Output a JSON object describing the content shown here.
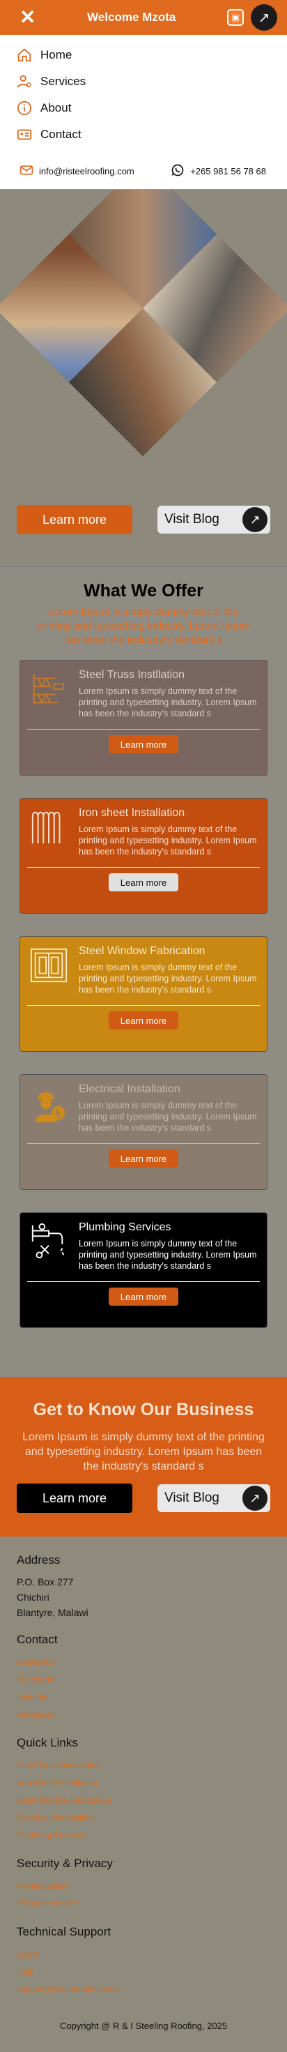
{
  "topbar": {
    "title": "Welcome Mzota"
  },
  "menu": [
    {
      "label": "Home"
    },
    {
      "label": "Services"
    },
    {
      "label": "About"
    },
    {
      "label": "Contact"
    }
  ],
  "contact": {
    "email": "info@risteelroofing.com",
    "phone": "+265 981 56 78 68"
  },
  "hero": {
    "learn_more": "Learn more",
    "visit_blog": "Visit Blog"
  },
  "offer": {
    "title": "What We Offer",
    "subtitle": "Lorem Ipsum is simply dummy text of the printing and typesetting industry. Lorem Ipsum has been the industry's standard s",
    "cards": [
      {
        "title": "Steel Truss Instllation",
        "text": "Lorem Ipsum is simply dummy text of the printing and typesetting industry. Lorem Ipsum has been the industry's standard s",
        "button": "Learn more",
        "bg": "#7a6660",
        "fg": "#d9cbc6",
        "btn_bg": "#d15a14",
        "btn_fg": "#fff"
      },
      {
        "title": "Iron sheet Installation",
        "text": "Lorem Ipsum is simply dummy text of the printing and typesetting industry. Lorem Ipsum has been the industry's standard s",
        "button": "Learn more",
        "bg": "#c24d0e",
        "fg": "#fbe2d3",
        "btn_bg": "#e0e0e0",
        "btn_fg": "#111"
      },
      {
        "title": "Steel Window Fabrication",
        "text": "Lorem Ipsum is simply dummy text of the printing and typesetting industry. Lorem Ipsum has been the industry's standard s",
        "button": "Learn more",
        "bg": "#c88812",
        "fg": "#fbe8c7",
        "btn_bg": "#d15a14",
        "btn_fg": "#fff"
      },
      {
        "title": "Electrical Installation",
        "text": "Lorem Ipsum is simply dummy text of the printing and typesetting industry. Lorem Ipsum has been the industry's standard s",
        "button": "Learn more",
        "bg": "#8a7d70",
        "fg": "#c9b9a8",
        "btn_bg": "#d15a14",
        "btn_fg": "#fff"
      },
      {
        "title": "Plumbing Services",
        "text": "Lorem Ipsum is simply dummy text of the printing and typesetting industry. Lorem Ipsum has been the industry's standard s",
        "button": "Learn more",
        "bg": "#000000",
        "fg": "#ffffff",
        "btn_bg": "#d15a14",
        "btn_fg": "#fff"
      }
    ]
  },
  "business": {
    "title": "Get to Know Our Business",
    "text": "Lorem Ipsum is simply dummy text of the printing and typesetting industry. Lorem Ipsum has been the industry's standard s",
    "learn_more": "Learn more",
    "visit_blog": "Visit Blog"
  },
  "footer": {
    "address": {
      "heading": "Address",
      "lines": [
        "P.O. Box 277",
        "Chichiri",
        "Blantyre, Malawi"
      ]
    },
    "contact": {
      "heading": "Contact",
      "links": [
        "WhatsApp",
        "Facebook",
        "Linkedin",
        "Instagram"
      ]
    },
    "quick": {
      "heading": "Quick Links",
      "links": [
        "Steel Truss Installation",
        "Iron Sheet Installation",
        "Steel Window Fabrication",
        "Electrical Installation",
        "Plumbing Services"
      ]
    },
    "security": {
      "heading": "Security & Privacy",
      "links": [
        "Privacy policy",
        "Terms of service"
      ]
    },
    "support": {
      "heading": "Technical Support",
      "links": [
        "Q & A",
        "Help",
        "support@risteelroofing.com"
      ]
    },
    "copyright": "Copyright @ R & I Steeling Roofing, 2025"
  }
}
